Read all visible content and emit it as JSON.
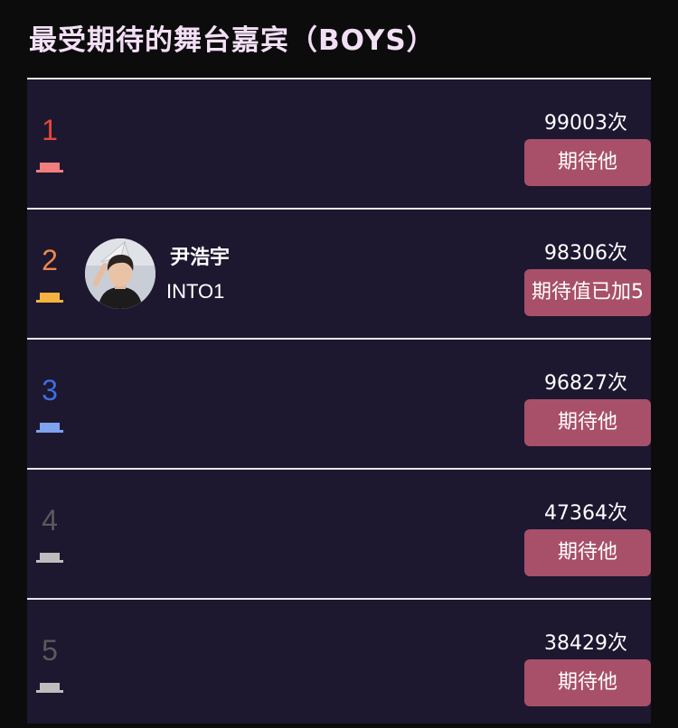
{
  "header": {
    "title": "最受期待的舞台嘉宾（BOYS）"
  },
  "colors": {
    "background": "#0c0c0c",
    "panel": "#1e1730",
    "title": "#f3dff5",
    "button": "#a8506a",
    "rank1": "#e4473d",
    "rank2": "#e8894a",
    "rank3": "#3a6fe0",
    "rank_other": "#5a5a5a"
  },
  "ranking": {
    "items": [
      {
        "rank": "1",
        "name": "",
        "group": "",
        "count": "99003次",
        "button_label": "期待他",
        "podium_color": "#f07e7e",
        "rank_color": "#e4473d"
      },
      {
        "rank": "2",
        "name": "尹浩宇",
        "group": "INTO1",
        "count": "98306次",
        "button_label": "期待值已加5",
        "podium_color": "#f4b240",
        "rank_color": "#e8894a"
      },
      {
        "rank": "3",
        "name": "",
        "group": "",
        "count": "96827次",
        "button_label": "期待他",
        "podium_color": "#7fa3ee",
        "rank_color": "#3a6fe0"
      },
      {
        "rank": "4",
        "name": "",
        "group": "",
        "count": "47364次",
        "button_label": "期待他",
        "podium_color": "#bdbdbd",
        "rank_color": "#5a5a5a"
      },
      {
        "rank": "5",
        "name": "",
        "group": "",
        "count": "38429次",
        "button_label": "期待他",
        "podium_color": "#bdbdbd",
        "rank_color": "#5a5a5a"
      }
    ]
  }
}
